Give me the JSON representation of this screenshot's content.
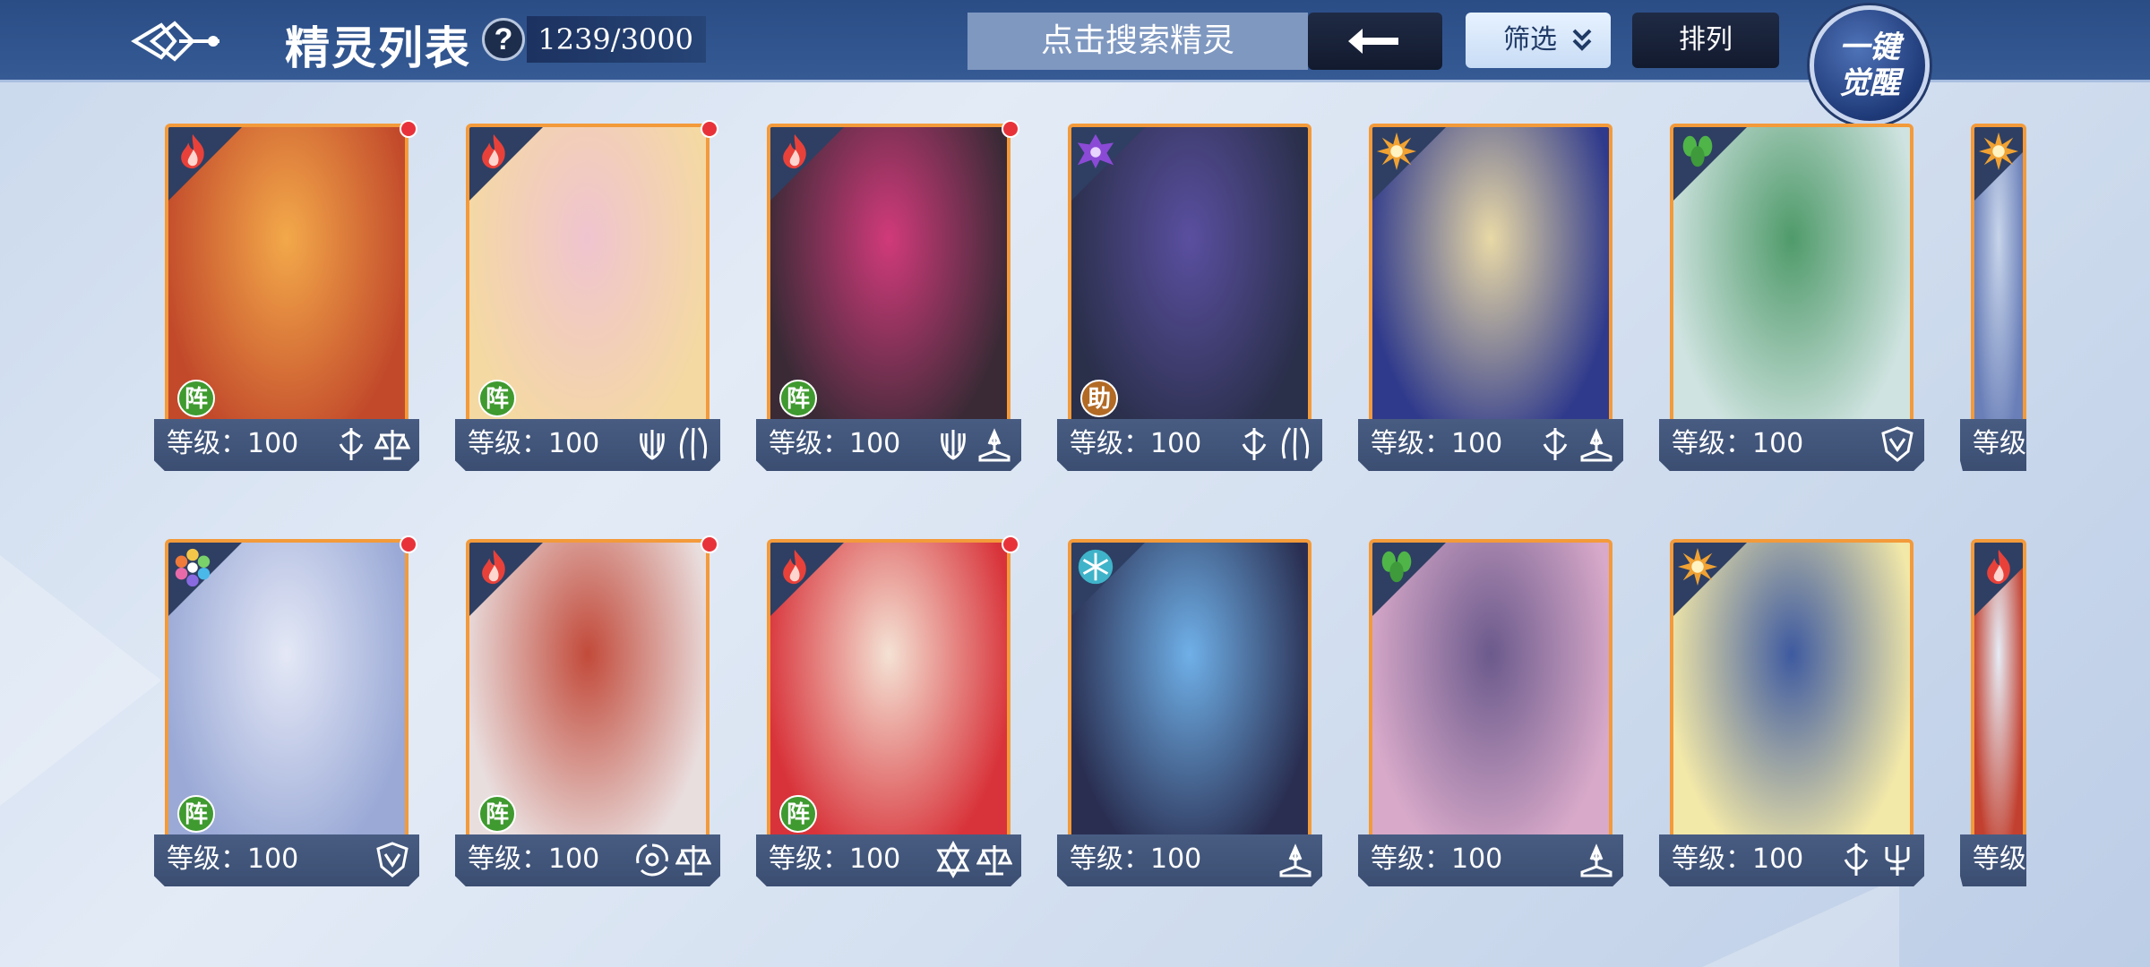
{
  "header": {
    "title": "精灵列表",
    "help": "?",
    "count": "1239/3000",
    "search_placeholder": "点击搜索精灵",
    "back_symbol": "⟵",
    "filter_label": "筛选",
    "sort_label": "排列",
    "awaken_label_line1": "一键",
    "awaken_label_line2": "觉醒"
  },
  "colors": {
    "topbar": "#2b4d86",
    "card_border": "#f39a3a",
    "footer": "#485c82",
    "red_dot": "#e8323a",
    "role_zhen": "#3f9a2f",
    "role_zhu": "#b26a25"
  },
  "cards": [
    {
      "level": "等级：100",
      "element": "fire-icon",
      "role": "阵",
      "reddot": true,
      "classes": [
        "sword-icon",
        "scale-icon"
      ],
      "art": [
        "#c24a2b",
        "#f3a94a"
      ]
    },
    {
      "level": "等级：100",
      "element": "fire-icon",
      "role": "阵",
      "reddot": true,
      "classes": [
        "fist-icon",
        "claw-icon"
      ],
      "art": [
        "#f4d9a3",
        "#f0c4cf"
      ]
    },
    {
      "level": "等级：100",
      "element": "fire-icon",
      "role": "阵",
      "reddot": true,
      "classes": [
        "fist-icon",
        "book-icon"
      ],
      "art": [
        "#3a2a36",
        "#d13a7a"
      ]
    },
    {
      "level": "等级：100",
      "element": "dark-icon",
      "role": "助",
      "reddot": false,
      "classes": [
        "sword-icon",
        "claw-icon"
      ],
      "art": [
        "#2a2f4a",
        "#5a4fa0"
      ]
    },
    {
      "level": "等级：100",
      "element": "light-icon",
      "role": "",
      "reddot": false,
      "classes": [
        "sword-icon",
        "book-icon"
      ],
      "art": [
        "#2f3a8c",
        "#e9d9a6"
      ]
    },
    {
      "level": "等级：100",
      "element": "wood-icon",
      "role": "",
      "reddot": false,
      "classes": [
        "shield-icon"
      ],
      "art": [
        "#cfe3e0",
        "#4f9a6a"
      ]
    },
    {
      "level": "等级",
      "element": "light-icon",
      "role": "",
      "reddot": false,
      "classes": [],
      "art": [
        "#6a7fb8",
        "#c7d4ea"
      ],
      "partial": true
    },
    {
      "level": "等级：100",
      "element": "rainbow-icon",
      "role": "阵",
      "reddot": true,
      "classes": [
        "shield-icon"
      ],
      "art": [
        "#9aa9d6",
        "#e4e8f6"
      ]
    },
    {
      "level": "等级：100",
      "element": "fire-icon",
      "role": "阵",
      "reddot": true,
      "classes": [
        "swirl-icon",
        "scale-icon"
      ],
      "art": [
        "#e9dede",
        "#c24a3a"
      ]
    },
    {
      "level": "等级：100",
      "element": "fire-icon",
      "role": "阵",
      "reddot": true,
      "classes": [
        "star-icon",
        "scale-icon"
      ],
      "art": [
        "#d8333a",
        "#f4e2d4"
      ]
    },
    {
      "level": "等级：100",
      "element": "ice-icon",
      "role": "",
      "reddot": false,
      "classes": [
        "book-icon"
      ],
      "art": [
        "#2a2f52",
        "#6fb0e8"
      ]
    },
    {
      "level": "等级：100",
      "element": "wood-icon",
      "role": "",
      "reddot": false,
      "classes": [
        "book-icon"
      ],
      "art": [
        "#d8a9c9",
        "#6b5a8c"
      ]
    },
    {
      "level": "等级：100",
      "element": "light-icon",
      "role": "",
      "reddot": false,
      "classes": [
        "sword-icon",
        "trident-icon"
      ],
      "art": [
        "#f2e8a8",
        "#3e5aa0"
      ]
    },
    {
      "level": "等级",
      "element": "fire-icon",
      "role": "",
      "reddot": false,
      "classes": [],
      "art": [
        "#c2402f",
        "#e6ecf6"
      ],
      "partial": true
    }
  ]
}
